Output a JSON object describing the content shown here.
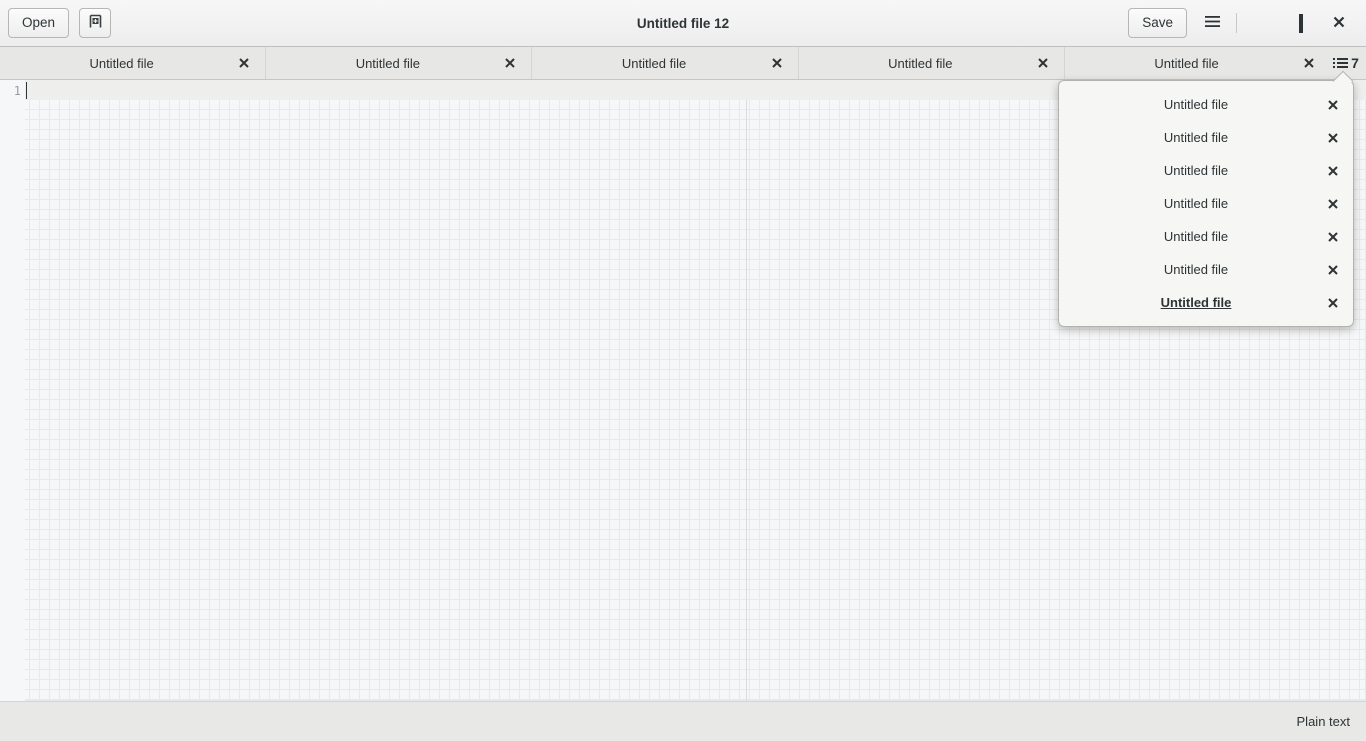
{
  "window": {
    "title": "Untitled file 12"
  },
  "headerbar": {
    "open_label": "Open",
    "new_tab_icon": "new-document-icon",
    "save_label": "Save",
    "menu_icon": "hamburger-menu-icon",
    "minimize_icon": "minimize-icon",
    "maximize_icon": "maximize-icon",
    "close_icon": "close-icon"
  },
  "tabbar": {
    "tabs": [
      {
        "label": "Untitled file",
        "close_icon": "close-icon"
      },
      {
        "label": "Untitled file",
        "close_icon": "close-icon"
      },
      {
        "label": "Untitled file",
        "close_icon": "close-icon"
      },
      {
        "label": "Untitled file",
        "close_icon": "close-icon"
      },
      {
        "label": "Untitled file",
        "close_icon": "close-icon"
      }
    ],
    "overview": {
      "icon": "tab-list-icon",
      "count": "7"
    }
  },
  "tab_popover": {
    "items": [
      {
        "label": "Untitled file",
        "active": false,
        "close_icon": "close-icon"
      },
      {
        "label": "Untitled file",
        "active": false,
        "close_icon": "close-icon"
      },
      {
        "label": "Untitled file",
        "active": false,
        "close_icon": "close-icon"
      },
      {
        "label": "Untitled file",
        "active": false,
        "close_icon": "close-icon"
      },
      {
        "label": "Untitled file",
        "active": false,
        "close_icon": "close-icon"
      },
      {
        "label": "Untitled file",
        "active": false,
        "close_icon": "close-icon"
      },
      {
        "label": "Untitled file",
        "active": true,
        "close_icon": "close-icon"
      }
    ]
  },
  "editor": {
    "line_numbers": [
      "1"
    ],
    "content": ""
  },
  "statusbar": {
    "language": "Plain text"
  },
  "colors": {
    "headerbar_top": "#f7f7f7",
    "headerbar_bottom": "#ededed",
    "tabbar_bg": "#e7e7e5",
    "editor_bg": "#f6f7f8",
    "grid_line": "#e7eaed",
    "statusbar_bg": "#e8e8e6",
    "text": "#2e3436"
  }
}
